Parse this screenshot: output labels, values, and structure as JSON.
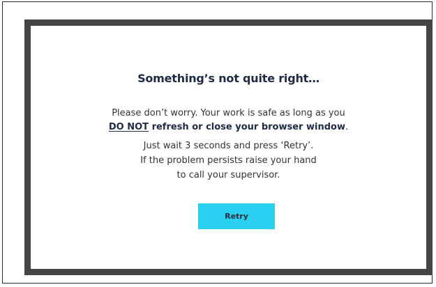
{
  "dialog": {
    "title": "Something’s not quite right…",
    "message_line_1": "Please don’t worry. Your work is safe as long as you",
    "warning_emphasis": "DO NOT",
    "warning_rest": " refresh or close your browser window",
    "warning_period": ".",
    "instruction_line_1": "Just wait 3 seconds and press ‘Retry’.",
    "instruction_line_2": "If the problem persists raise your hand",
    "instruction_line_3": "to call your supervisor.",
    "retry_label": "Retry"
  },
  "colors": {
    "frame": "#444444",
    "button": "#2ad0ef",
    "title_text": "#1f2a44"
  }
}
